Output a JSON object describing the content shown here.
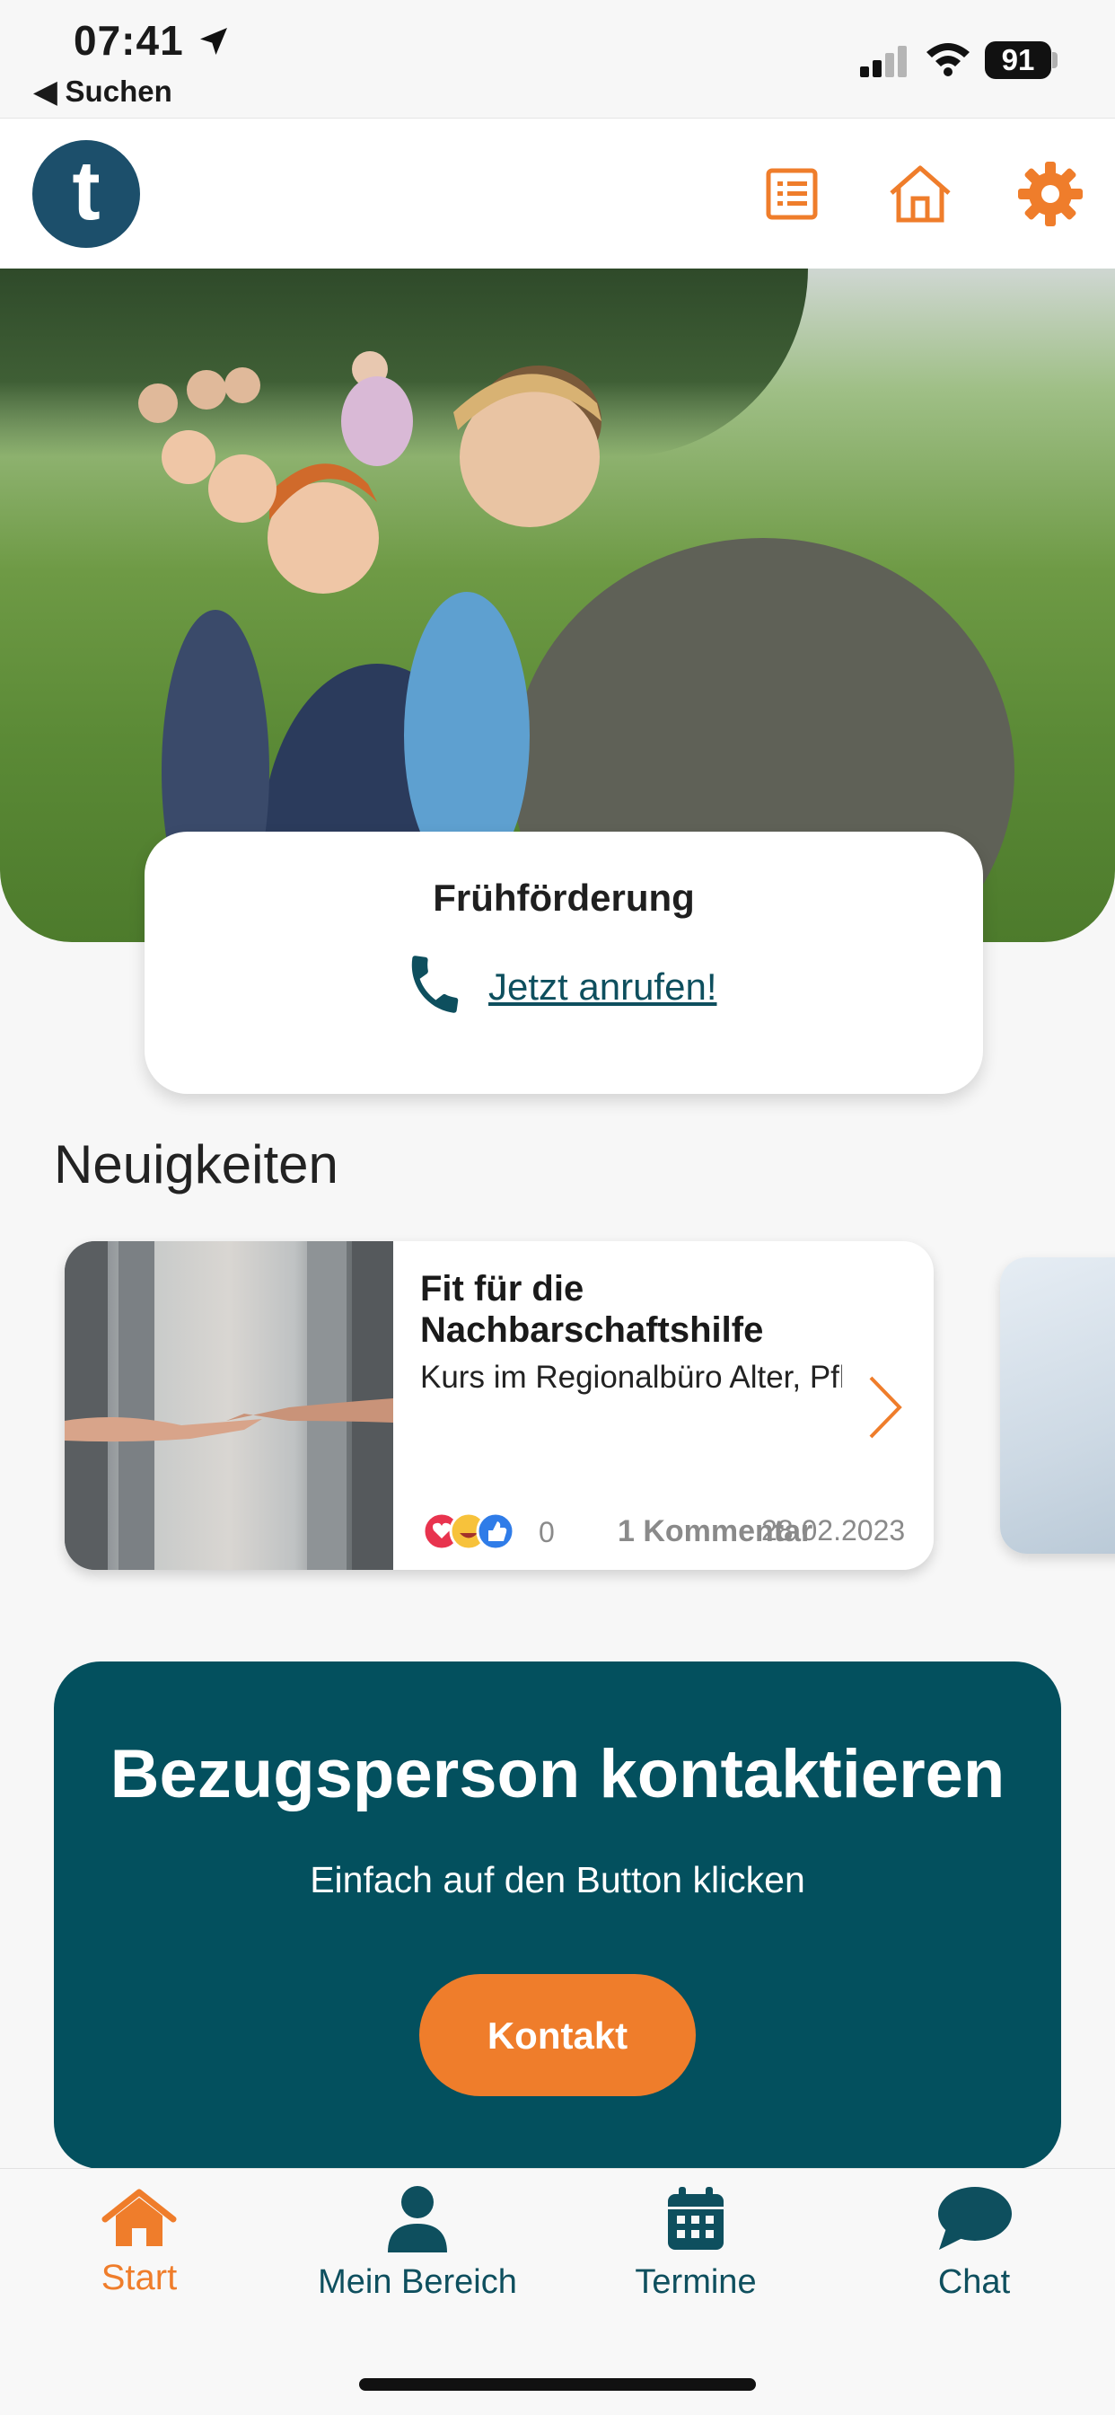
{
  "status_bar": {
    "time": "07:41",
    "back_label": "◀ Suchen",
    "battery": "91"
  },
  "header": {
    "logo_letter": "t",
    "icons": [
      "list-icon",
      "home-icon",
      "gear-icon"
    ],
    "accent_color": "#ef7d2b"
  },
  "hero_card": {
    "title": "Frühförderung",
    "call_label": "Jetzt anrufen!"
  },
  "news": {
    "section_title": "Neuigkeiten",
    "items": [
      {
        "title": "Fit für die Nachbarschaftshilfe",
        "subtitle": "Kurs im Regionalbüro Alter, Pflege und Demen...",
        "reactions_count": "0",
        "comments": "1 Kommentar",
        "date": "28.02.2023"
      }
    ]
  },
  "contact": {
    "title": "Bezugsperson kontaktieren",
    "subtitle": "Einfach auf den Button klicken",
    "button": "Kontakt",
    "panel_color": "#03505e"
  },
  "tabbar": {
    "tabs": [
      {
        "label": "Start",
        "icon": "home-icon",
        "active": true
      },
      {
        "label": "Mein Bereich",
        "icon": "person-icon",
        "active": false
      },
      {
        "label": "Termine",
        "icon": "calendar-icon",
        "active": false
      },
      {
        "label": "Chat",
        "icon": "chat-bubble-icon",
        "active": false
      }
    ]
  }
}
